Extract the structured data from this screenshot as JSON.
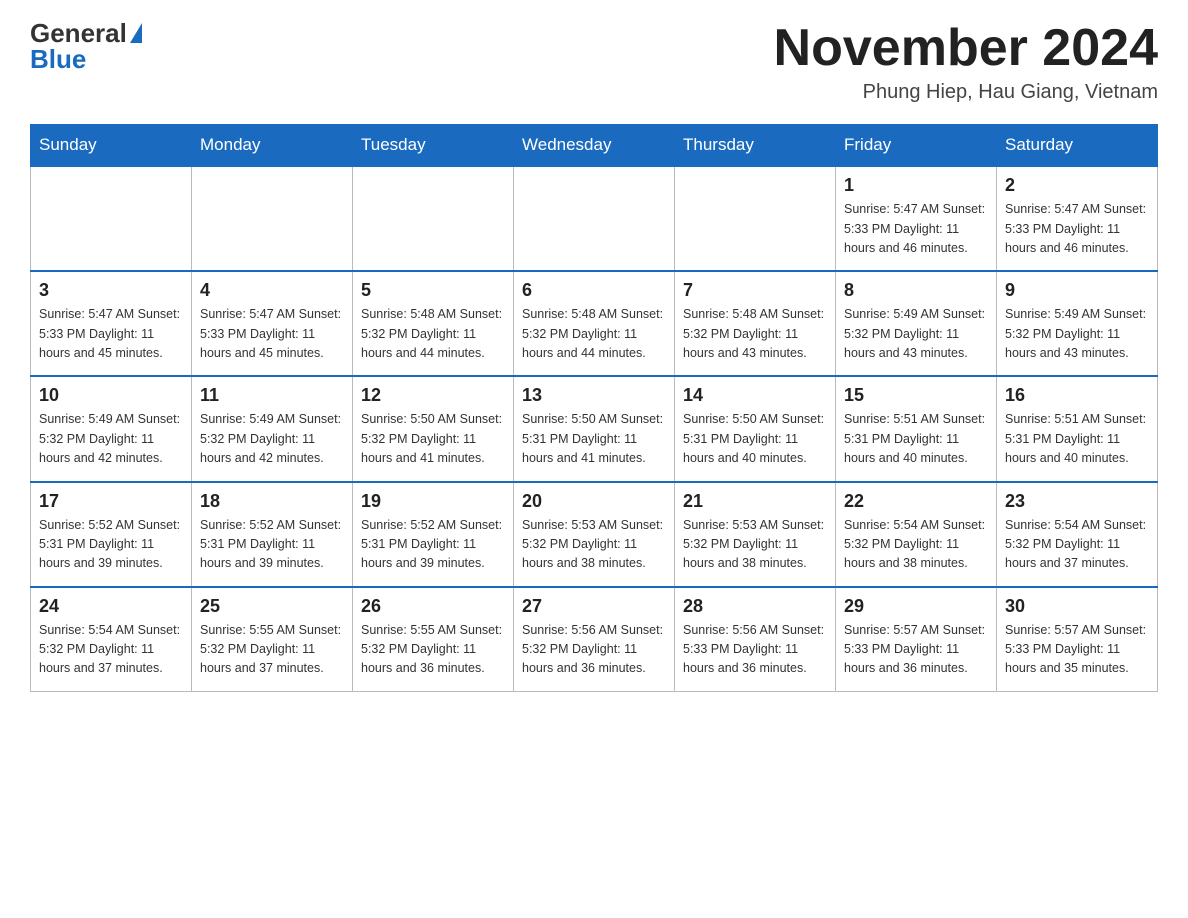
{
  "header": {
    "logo_general": "General",
    "logo_blue": "Blue",
    "month_title": "November 2024",
    "location": "Phung Hiep, Hau Giang, Vietnam"
  },
  "days_of_week": [
    "Sunday",
    "Monday",
    "Tuesday",
    "Wednesday",
    "Thursday",
    "Friday",
    "Saturday"
  ],
  "weeks": [
    [
      {
        "day": "",
        "info": ""
      },
      {
        "day": "",
        "info": ""
      },
      {
        "day": "",
        "info": ""
      },
      {
        "day": "",
        "info": ""
      },
      {
        "day": "",
        "info": ""
      },
      {
        "day": "1",
        "info": "Sunrise: 5:47 AM\nSunset: 5:33 PM\nDaylight: 11 hours and 46 minutes."
      },
      {
        "day": "2",
        "info": "Sunrise: 5:47 AM\nSunset: 5:33 PM\nDaylight: 11 hours and 46 minutes."
      }
    ],
    [
      {
        "day": "3",
        "info": "Sunrise: 5:47 AM\nSunset: 5:33 PM\nDaylight: 11 hours and 45 minutes."
      },
      {
        "day": "4",
        "info": "Sunrise: 5:47 AM\nSunset: 5:33 PM\nDaylight: 11 hours and 45 minutes."
      },
      {
        "day": "5",
        "info": "Sunrise: 5:48 AM\nSunset: 5:32 PM\nDaylight: 11 hours and 44 minutes."
      },
      {
        "day": "6",
        "info": "Sunrise: 5:48 AM\nSunset: 5:32 PM\nDaylight: 11 hours and 44 minutes."
      },
      {
        "day": "7",
        "info": "Sunrise: 5:48 AM\nSunset: 5:32 PM\nDaylight: 11 hours and 43 minutes."
      },
      {
        "day": "8",
        "info": "Sunrise: 5:49 AM\nSunset: 5:32 PM\nDaylight: 11 hours and 43 minutes."
      },
      {
        "day": "9",
        "info": "Sunrise: 5:49 AM\nSunset: 5:32 PM\nDaylight: 11 hours and 43 minutes."
      }
    ],
    [
      {
        "day": "10",
        "info": "Sunrise: 5:49 AM\nSunset: 5:32 PM\nDaylight: 11 hours and 42 minutes."
      },
      {
        "day": "11",
        "info": "Sunrise: 5:49 AM\nSunset: 5:32 PM\nDaylight: 11 hours and 42 minutes."
      },
      {
        "day": "12",
        "info": "Sunrise: 5:50 AM\nSunset: 5:32 PM\nDaylight: 11 hours and 41 minutes."
      },
      {
        "day": "13",
        "info": "Sunrise: 5:50 AM\nSunset: 5:31 PM\nDaylight: 11 hours and 41 minutes."
      },
      {
        "day": "14",
        "info": "Sunrise: 5:50 AM\nSunset: 5:31 PM\nDaylight: 11 hours and 40 minutes."
      },
      {
        "day": "15",
        "info": "Sunrise: 5:51 AM\nSunset: 5:31 PM\nDaylight: 11 hours and 40 minutes."
      },
      {
        "day": "16",
        "info": "Sunrise: 5:51 AM\nSunset: 5:31 PM\nDaylight: 11 hours and 40 minutes."
      }
    ],
    [
      {
        "day": "17",
        "info": "Sunrise: 5:52 AM\nSunset: 5:31 PM\nDaylight: 11 hours and 39 minutes."
      },
      {
        "day": "18",
        "info": "Sunrise: 5:52 AM\nSunset: 5:31 PM\nDaylight: 11 hours and 39 minutes."
      },
      {
        "day": "19",
        "info": "Sunrise: 5:52 AM\nSunset: 5:31 PM\nDaylight: 11 hours and 39 minutes."
      },
      {
        "day": "20",
        "info": "Sunrise: 5:53 AM\nSunset: 5:32 PM\nDaylight: 11 hours and 38 minutes."
      },
      {
        "day": "21",
        "info": "Sunrise: 5:53 AM\nSunset: 5:32 PM\nDaylight: 11 hours and 38 minutes."
      },
      {
        "day": "22",
        "info": "Sunrise: 5:54 AM\nSunset: 5:32 PM\nDaylight: 11 hours and 38 minutes."
      },
      {
        "day": "23",
        "info": "Sunrise: 5:54 AM\nSunset: 5:32 PM\nDaylight: 11 hours and 37 minutes."
      }
    ],
    [
      {
        "day": "24",
        "info": "Sunrise: 5:54 AM\nSunset: 5:32 PM\nDaylight: 11 hours and 37 minutes."
      },
      {
        "day": "25",
        "info": "Sunrise: 5:55 AM\nSunset: 5:32 PM\nDaylight: 11 hours and 37 minutes."
      },
      {
        "day": "26",
        "info": "Sunrise: 5:55 AM\nSunset: 5:32 PM\nDaylight: 11 hours and 36 minutes."
      },
      {
        "day": "27",
        "info": "Sunrise: 5:56 AM\nSunset: 5:32 PM\nDaylight: 11 hours and 36 minutes."
      },
      {
        "day": "28",
        "info": "Sunrise: 5:56 AM\nSunset: 5:33 PM\nDaylight: 11 hours and 36 minutes."
      },
      {
        "day": "29",
        "info": "Sunrise: 5:57 AM\nSunset: 5:33 PM\nDaylight: 11 hours and 36 minutes."
      },
      {
        "day": "30",
        "info": "Sunrise: 5:57 AM\nSunset: 5:33 PM\nDaylight: 11 hours and 35 minutes."
      }
    ]
  ]
}
